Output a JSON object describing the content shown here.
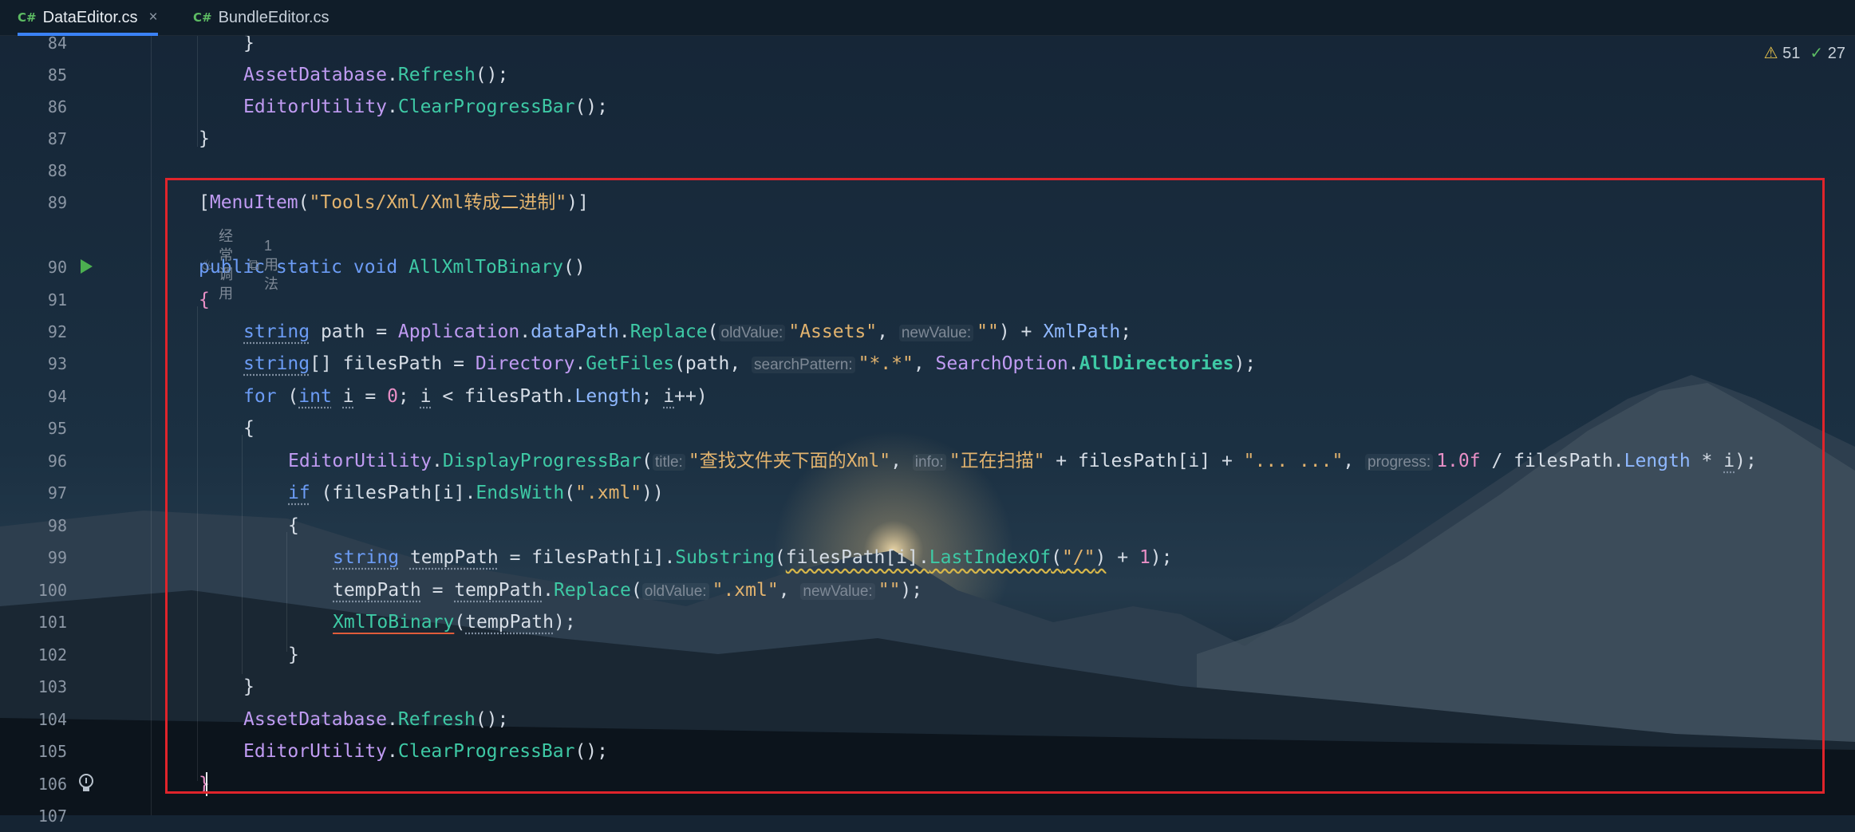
{
  "tabs": [
    {
      "lang": "C#",
      "label": "DataEditor.cs",
      "active": true,
      "close": "×"
    },
    {
      "lang": "C#",
      "label": "BundleEditor.cs",
      "active": false
    }
  ],
  "inspections": {
    "warnings": "51",
    "ok": "27"
  },
  "inlay": {
    "usage_hot": "经常调用",
    "usages": "1 用法"
  },
  "line_numbers": [
    "84",
    "85",
    "86",
    "87",
    "88",
    "89",
    "90",
    "91",
    "92",
    "93",
    "94",
    "95",
    "96",
    "97",
    "98",
    "99",
    "100",
    "101",
    "102",
    "103",
    "104",
    "105",
    "106",
    "107"
  ],
  "code": {
    "l85": {
      "obj": "AssetDatabase",
      "method": "Refresh"
    },
    "l86": {
      "obj": "EditorUtility",
      "method": "ClearProgressBar"
    },
    "l89": {
      "attr": "MenuItem",
      "arg": "\"Tools/Xml/Xml转成二进制\""
    },
    "l90": {
      "mods": "public static void",
      "name": "AllXmlToBinary"
    },
    "l92": {
      "type": "string",
      "var": "path",
      "obj": "Application",
      "prop": "dataPath",
      "method": "Replace",
      "hint1": "oldValue:",
      "arg1": "\"Assets\"",
      "hint2": "newValue:",
      "arg2": "\"\"",
      "tail": "XmlPath"
    },
    "l93": {
      "type": "string",
      "var": "filesPath",
      "obj": "Directory",
      "method": "GetFiles",
      "hint": "searchPattern:",
      "arg": "\"*.*\"",
      "enum": "SearchOption",
      "member": "AllDirectories"
    },
    "l94": {
      "kw": "for",
      "type": "int",
      "zero": "0"
    },
    "l96": {
      "obj": "EditorUtility",
      "method": "DisplayProgressBar",
      "hint1": "title:",
      "arg1": "\"查找文件夹下面的Xml\"",
      "hint2": "info:",
      "arg2": "\"正在扫描\"",
      "arg3": "\"... ...\"",
      "hint3": "progress:",
      "num": "1.0f"
    },
    "l97": {
      "kw": "if",
      "method": "EndsWith",
      "arg": "\".xml\""
    },
    "l99": {
      "type": "string",
      "var": "tempPath",
      "method": "Substring",
      "method2": "LastIndexOf",
      "arg": "\"/\"",
      "one": "1"
    },
    "l100": {
      "method": "Replace",
      "hint1": "oldValue:",
      "arg1": "\".xml\"",
      "hint2": "newValue:",
      "arg2": "\"\""
    },
    "l101": {
      "call": "XmlToBinary"
    },
    "l104": {
      "obj": "AssetDatabase",
      "method": "Refresh"
    },
    "l105": {
      "obj": "EditorUtility",
      "method": "ClearProgressBar"
    }
  }
}
